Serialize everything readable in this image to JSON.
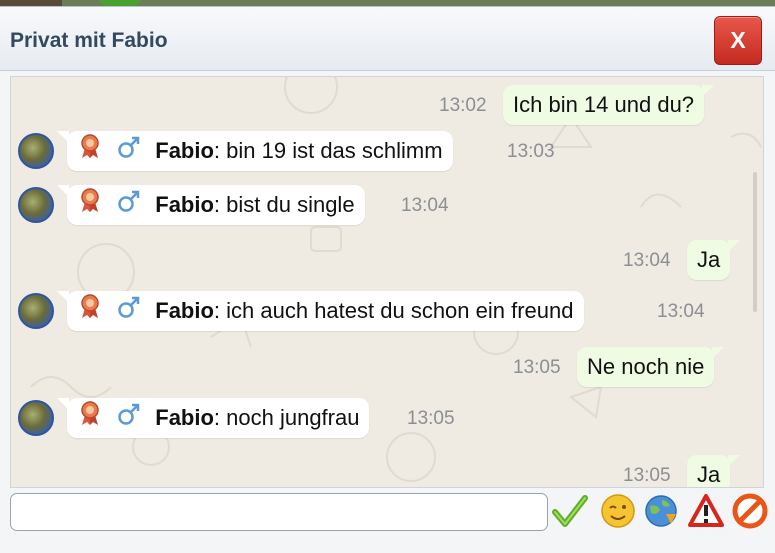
{
  "window": {
    "title": "Privat mit Fabio",
    "close_label": "X"
  },
  "messages": [
    {
      "dir": "out",
      "text": "Ich bin 14 und du?",
      "time": "13:02"
    },
    {
      "dir": "in",
      "sender": "Fabio",
      "text": ": bin 19 ist das schlimm",
      "time": "13:03"
    },
    {
      "dir": "in",
      "sender": "Fabio",
      "text": ": bist du single",
      "time": "13:04"
    },
    {
      "dir": "out",
      "text": "Ja",
      "time": "13:04"
    },
    {
      "dir": "in",
      "sender": "Fabio",
      "text": ": ich auch hatest du schon ein freund",
      "time": "13:04"
    },
    {
      "dir": "out",
      "text": "Ne noch nie",
      "time": "13:05"
    },
    {
      "dir": "in",
      "sender": "Fabio",
      "text": ": noch jungfrau",
      "time": "13:05"
    },
    {
      "dir": "out",
      "text": "Ja",
      "time": "13:05"
    }
  ],
  "input": {
    "value": "",
    "placeholder": ""
  },
  "toolbar": {
    "icons": [
      "checkmark-icon",
      "smiley-icon",
      "globe-icon",
      "warning-icon",
      "block-icon"
    ]
  },
  "colors": {
    "close_button": "#d9372c",
    "title_text": "#33495f",
    "outgoing_bubble": "#f0fbe4",
    "incoming_bubble": "#ffffff",
    "chat_background": "#efeae2"
  }
}
